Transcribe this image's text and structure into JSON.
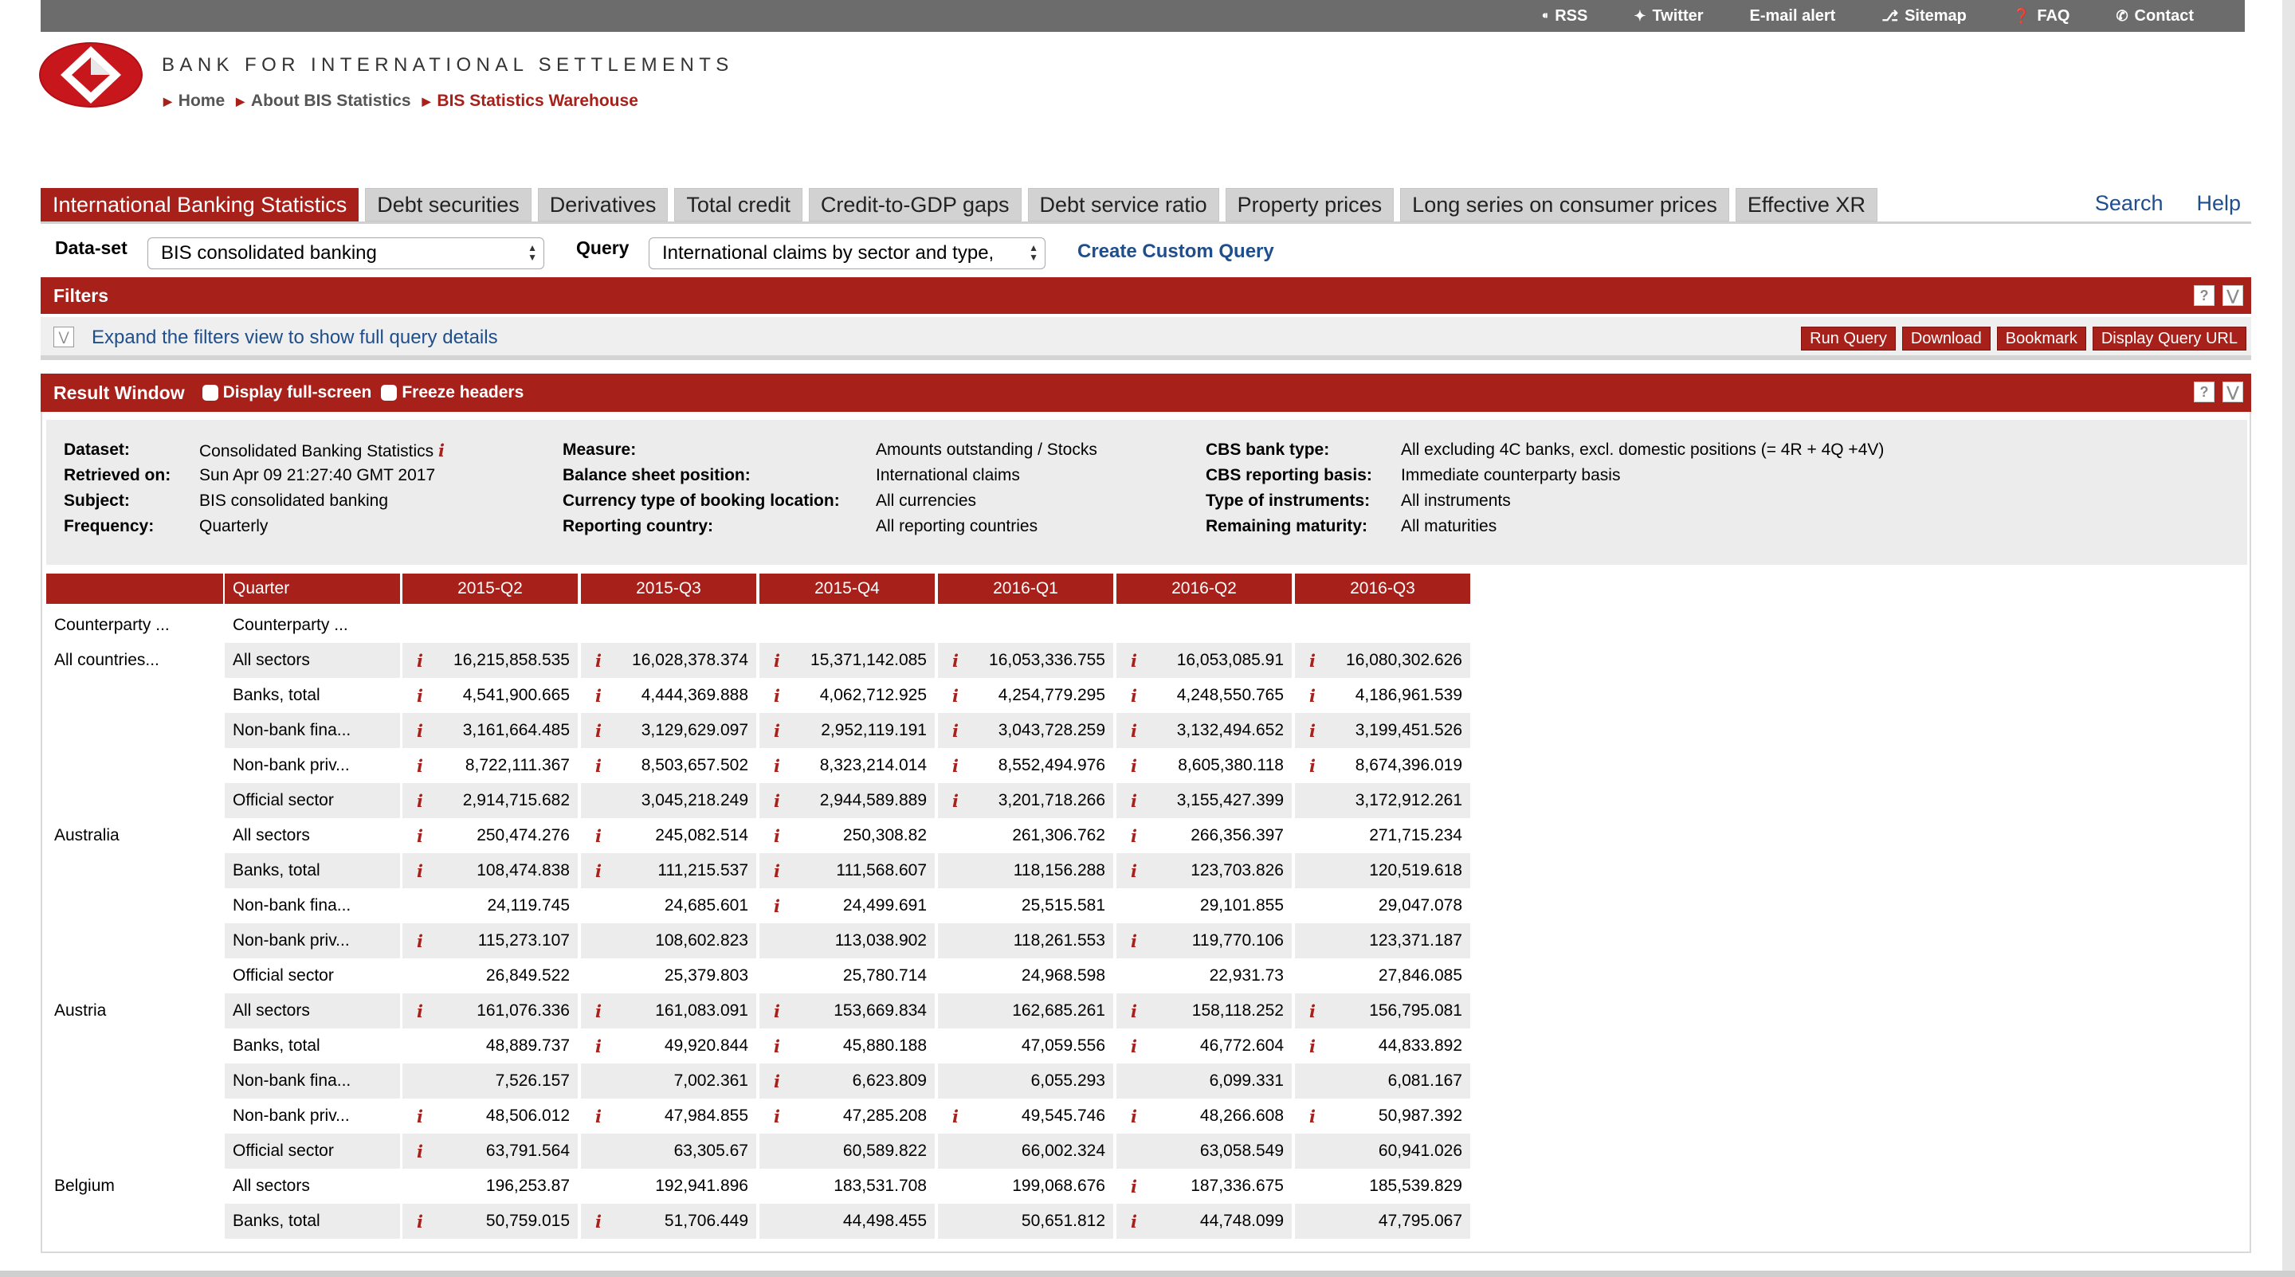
{
  "top_links": [
    "RSS",
    "Twitter",
    "E-mail alert",
    "Sitemap",
    "FAQ",
    "Contact"
  ],
  "site": {
    "title": "BANK FOR INTERNATIONAL SETTLEMENTS",
    "breadcrumb": [
      "Home",
      "About BIS Statistics",
      "BIS Statistics Warehouse"
    ]
  },
  "tabs": [
    "International Banking Statistics",
    "Debt securities",
    "Derivatives",
    "Total credit",
    "Credit-to-GDP gaps",
    "Debt service ratio",
    "Property prices",
    "Long series on consumer prices",
    "Effective XR"
  ],
  "active_tab": 0,
  "tab_links": [
    "Search",
    "Help"
  ],
  "query_bar": {
    "dataset_label": "Data-set",
    "dataset_value": "BIS consolidated banking",
    "query_label": "Query",
    "query_value": "International claims by sector and type,",
    "custom_query": "Create Custom Query"
  },
  "filters": {
    "title": "Filters",
    "expand_text": "Expand the filters view to show full query details",
    "buttons": [
      "Run Query",
      "Download",
      "Bookmark",
      "Display Query URL"
    ]
  },
  "result": {
    "title": "Result Window",
    "fullscreen": "Display full-screen",
    "freeze": "Freeze headers"
  },
  "meta": {
    "col1": [
      [
        "Dataset:",
        "Consolidated Banking Statistics"
      ],
      [
        "Retrieved on:",
        "Sun Apr 09 21:27:40 GMT 2017"
      ],
      [
        "Subject:",
        "BIS consolidated banking"
      ],
      [
        "Frequency:",
        "Quarterly"
      ]
    ],
    "col2": [
      [
        "Measure:",
        "Amounts outstanding / Stocks"
      ],
      [
        "Balance sheet position:",
        "International claims"
      ],
      [
        "Currency type of booking location:",
        "All currencies"
      ],
      [
        "Reporting country:",
        "All reporting countries"
      ]
    ],
    "col3": [
      [
        "CBS bank type:",
        "All excluding 4C banks, excl. domestic positions (= 4R + 4Q +4V)"
      ],
      [
        "CBS reporting basis:",
        "Immediate counterparty basis"
      ],
      [
        "Type of instruments:",
        "All instruments"
      ],
      [
        "Remaining maturity:",
        "All maturities"
      ]
    ]
  },
  "table": {
    "quarter_label": "Quarter",
    "periods": [
      "2015-Q2",
      "2015-Q3",
      "2015-Q4",
      "2016-Q1",
      "2016-Q2",
      "2016-Q3"
    ],
    "head_labels": [
      "Counterparty ...",
      "Counterparty ..."
    ],
    "rows": [
      {
        "country": "All countries...",
        "sector": "All sectors",
        "values": [
          "16,215,858.535",
          "16,028,378.374",
          "15,371,142.085",
          "16,053,336.755",
          "16,053,085.91",
          "16,080,302.626"
        ],
        "icons": [
          1,
          1,
          1,
          1,
          1,
          1
        ]
      },
      {
        "country": "",
        "sector": "Banks, total",
        "values": [
          "4,541,900.665",
          "4,444,369.888",
          "4,062,712.925",
          "4,254,779.295",
          "4,248,550.765",
          "4,186,961.539"
        ],
        "icons": [
          1,
          1,
          1,
          1,
          1,
          1
        ]
      },
      {
        "country": "",
        "sector": "Non-bank fina...",
        "values": [
          "3,161,664.485",
          "3,129,629.097",
          "2,952,119.191",
          "3,043,728.259",
          "3,132,494.652",
          "3,199,451.526"
        ],
        "icons": [
          1,
          1,
          1,
          1,
          1,
          1
        ]
      },
      {
        "country": "",
        "sector": "Non-bank priv...",
        "values": [
          "8,722,111.367",
          "8,503,657.502",
          "8,323,214.014",
          "8,552,494.976",
          "8,605,380.118",
          "8,674,396.019"
        ],
        "icons": [
          1,
          1,
          1,
          1,
          1,
          1
        ]
      },
      {
        "country": "",
        "sector": "Official sector",
        "values": [
          "2,914,715.682",
          "3,045,218.249",
          "2,944,589.889",
          "3,201,718.266",
          "3,155,427.399",
          "3,172,912.261"
        ],
        "icons": [
          1,
          0,
          1,
          1,
          1,
          0
        ]
      },
      {
        "country": "Australia",
        "sector": "All sectors",
        "values": [
          "250,474.276",
          "245,082.514",
          "250,308.82",
          "261,306.762",
          "266,356.397",
          "271,715.234"
        ],
        "icons": [
          1,
          1,
          1,
          0,
          1,
          0
        ]
      },
      {
        "country": "",
        "sector": "Banks, total",
        "values": [
          "108,474.838",
          "111,215.537",
          "111,568.607",
          "118,156.288",
          "123,703.826",
          "120,519.618"
        ],
        "icons": [
          1,
          1,
          1,
          0,
          1,
          0
        ]
      },
      {
        "country": "",
        "sector": "Non-bank fina...",
        "values": [
          "24,119.745",
          "24,685.601",
          "24,499.691",
          "25,515.581",
          "29,101.855",
          "29,047.078"
        ],
        "icons": [
          0,
          0,
          1,
          0,
          0,
          0
        ]
      },
      {
        "country": "",
        "sector": "Non-bank priv...",
        "values": [
          "115,273.107",
          "108,602.823",
          "113,038.902",
          "118,261.553",
          "119,770.106",
          "123,371.187"
        ],
        "icons": [
          1,
          0,
          0,
          0,
          1,
          0
        ]
      },
      {
        "country": "",
        "sector": "Official sector",
        "values": [
          "26,849.522",
          "25,379.803",
          "25,780.714",
          "24,968.598",
          "22,931.73",
          "27,846.085"
        ],
        "icons": [
          0,
          0,
          0,
          0,
          0,
          0
        ]
      },
      {
        "country": "Austria",
        "sector": "All sectors",
        "values": [
          "161,076.336",
          "161,083.091",
          "153,669.834",
          "162,685.261",
          "158,118.252",
          "156,795.081"
        ],
        "icons": [
          1,
          1,
          1,
          0,
          1,
          1
        ]
      },
      {
        "country": "",
        "sector": "Banks, total",
        "values": [
          "48,889.737",
          "49,920.844",
          "45,880.188",
          "47,059.556",
          "46,772.604",
          "44,833.892"
        ],
        "icons": [
          0,
          1,
          1,
          0,
          1,
          1
        ]
      },
      {
        "country": "",
        "sector": "Non-bank fina...",
        "values": [
          "7,526.157",
          "7,002.361",
          "6,623.809",
          "6,055.293",
          "6,099.331",
          "6,081.167"
        ],
        "icons": [
          0,
          0,
          1,
          0,
          0,
          0
        ]
      },
      {
        "country": "",
        "sector": "Non-bank priv...",
        "values": [
          "48,506.012",
          "47,984.855",
          "47,285.208",
          "49,545.746",
          "48,266.608",
          "50,987.392"
        ],
        "icons": [
          1,
          1,
          1,
          1,
          1,
          1
        ]
      },
      {
        "country": "",
        "sector": "Official sector",
        "values": [
          "63,791.564",
          "63,305.67",
          "60,589.822",
          "66,002.324",
          "63,058.549",
          "60,941.026"
        ],
        "icons": [
          1,
          0,
          0,
          0,
          0,
          0
        ]
      },
      {
        "country": "Belgium",
        "sector": "All sectors",
        "values": [
          "196,253.87",
          "192,941.896",
          "183,531.708",
          "199,068.676",
          "187,336.675",
          "185,539.829"
        ],
        "icons": [
          0,
          0,
          0,
          0,
          1,
          0
        ]
      },
      {
        "country": "",
        "sector": "Banks, total",
        "values": [
          "50,759.015",
          "51,706.449",
          "44,498.455",
          "50,651.812",
          "44,748.099",
          "47,795.067"
        ],
        "icons": [
          1,
          1,
          0,
          0,
          1,
          0
        ]
      }
    ]
  }
}
